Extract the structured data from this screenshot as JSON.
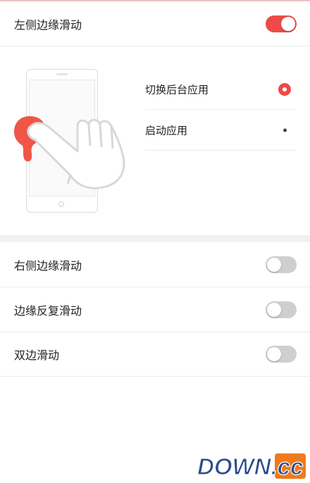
{
  "left_edge_swipe": {
    "label": "左侧边缘滑动",
    "enabled": true
  },
  "left_edge_options": [
    {
      "label": "切换后台应用",
      "selected": true
    },
    {
      "label": "启动应用",
      "selected": false
    }
  ],
  "right_edge_swipe": {
    "label": "右侧边缘滑动",
    "enabled": false
  },
  "edge_repeat_swipe": {
    "label": "边缘反复滑动",
    "enabled": false
  },
  "double_edge_swipe": {
    "label": "双边滑动",
    "enabled": false
  },
  "watermark": {
    "text": "DOWN.cc"
  },
  "colors": {
    "accent": "#ee4a47",
    "toggle_off": "#cfcfcf",
    "separator": "#f1f1f1",
    "watermark_blue": "#2c4b8e"
  },
  "icons": [
    "phone-illustration",
    "hand-swipe-icon",
    "radio-selected-icon",
    "radio-unselected-icon"
  ]
}
